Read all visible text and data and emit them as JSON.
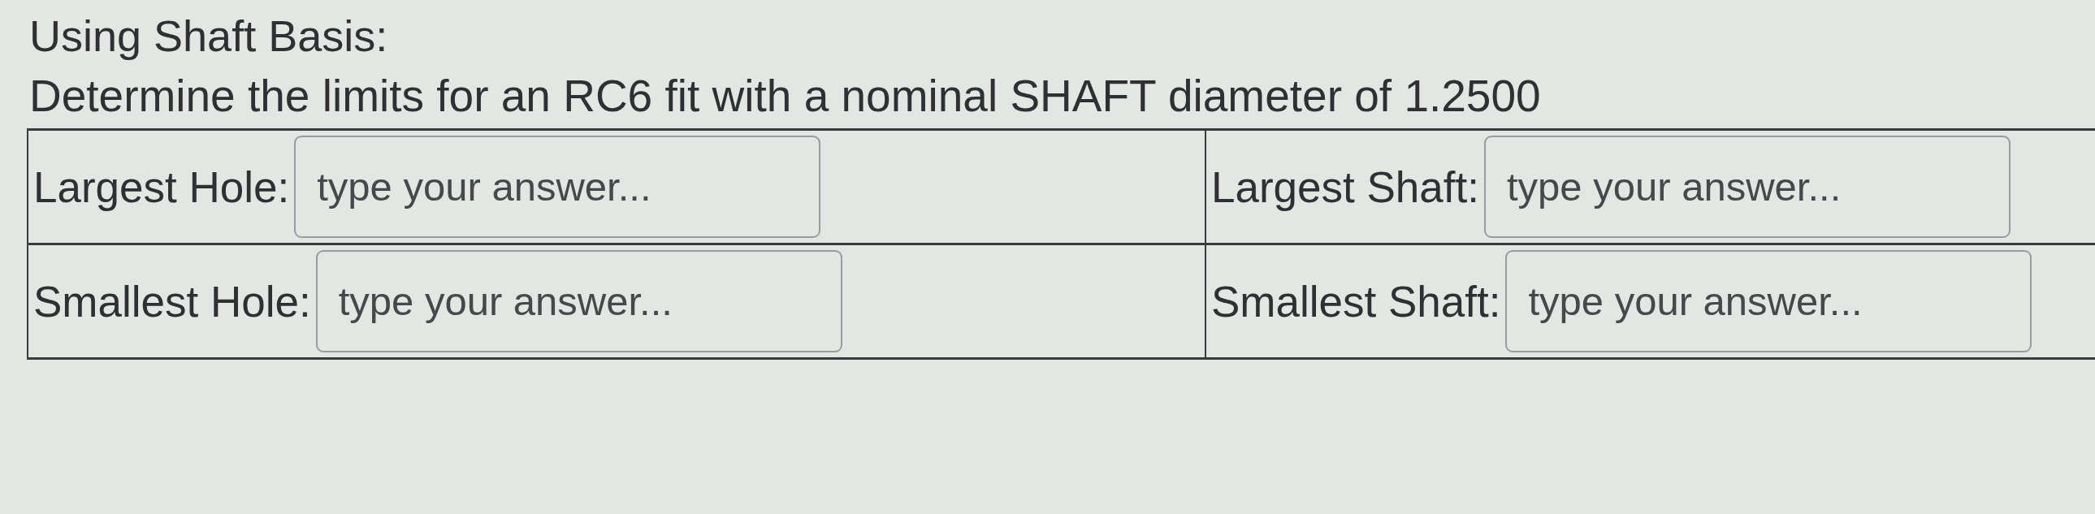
{
  "heading": "Using Shaft Basis:",
  "prompt": "Determine the limits for an RC6 fit with a nominal SHAFT diameter of 1.2500",
  "table": {
    "rows": [
      {
        "cells": [
          {
            "label": "Largest Hole:",
            "answer": {
              "placeholder": "type your answer..."
            }
          },
          {
            "label": "Largest Shaft:",
            "answer": {
              "placeholder": "type your answer..."
            }
          }
        ]
      },
      {
        "cells": [
          {
            "label": "Smallest Hole:",
            "answer": {
              "placeholder": "type your answer..."
            }
          },
          {
            "label": "Smallest Shaft:",
            "answer": {
              "placeholder": "type your answer..."
            }
          }
        ]
      }
    ]
  }
}
